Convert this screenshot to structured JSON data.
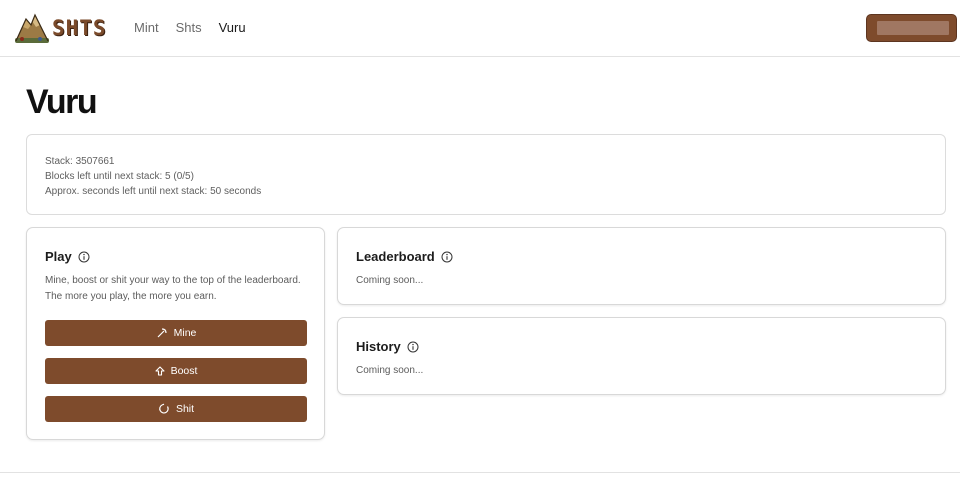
{
  "header": {
    "logo_text": "SHTS",
    "nav": [
      {
        "label": "Mint",
        "active": false
      },
      {
        "label": "Shts",
        "active": false
      },
      {
        "label": "Vuru",
        "active": true
      }
    ]
  },
  "page": {
    "title": "Vuru"
  },
  "stats": {
    "stack": "Stack: 3507661",
    "blocks_left": "Blocks left until next stack: 5 (0/5)",
    "seconds_left": "Approx. seconds left until next stack: 50 seconds"
  },
  "play": {
    "title": "Play",
    "description": "Mine, boost or shit your way to the top of the leaderboard. The more you play, the more you earn.",
    "buttons": [
      {
        "label": "Mine",
        "icon": "pickaxe-icon"
      },
      {
        "label": "Boost",
        "icon": "arrow-up-icon"
      },
      {
        "label": "Shit",
        "icon": "swirl-icon"
      }
    ]
  },
  "leaderboard": {
    "title": "Leaderboard",
    "status": "Coming soon..."
  },
  "history": {
    "title": "History",
    "status": "Coming soon..."
  },
  "colors": {
    "accent": "#7e4b2c",
    "accent_light": "#a07762"
  }
}
